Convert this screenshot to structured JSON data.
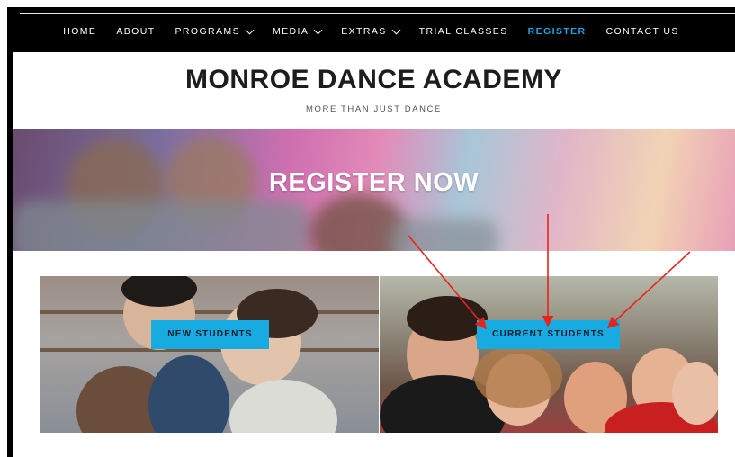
{
  "nav": {
    "items": [
      {
        "label": "HOME",
        "dropdown": false,
        "active": false
      },
      {
        "label": "ABOUT",
        "dropdown": false,
        "active": false
      },
      {
        "label": "PROGRAMS",
        "dropdown": true,
        "active": false
      },
      {
        "label": "MEDIA",
        "dropdown": true,
        "active": false
      },
      {
        "label": "EXTRAS",
        "dropdown": true,
        "active": false
      },
      {
        "label": "TRIAL CLASSES",
        "dropdown": false,
        "active": false
      },
      {
        "label": "REGISTER",
        "dropdown": false,
        "active": true
      },
      {
        "label": "CONTACT US",
        "dropdown": false,
        "active": false
      }
    ]
  },
  "header": {
    "title": "MONROE DANCE ACADEMY",
    "tagline": "MORE THAN JUST DANCE"
  },
  "hero": {
    "title": "REGISTER NOW"
  },
  "panels": {
    "new_students_label": "NEW STUDENTS",
    "current_students_label": "CURRENT STUDENTS"
  },
  "colors": {
    "accent": "#1fa5e0",
    "button": "#17abe2",
    "annotation_arrow": "#e8231e"
  }
}
